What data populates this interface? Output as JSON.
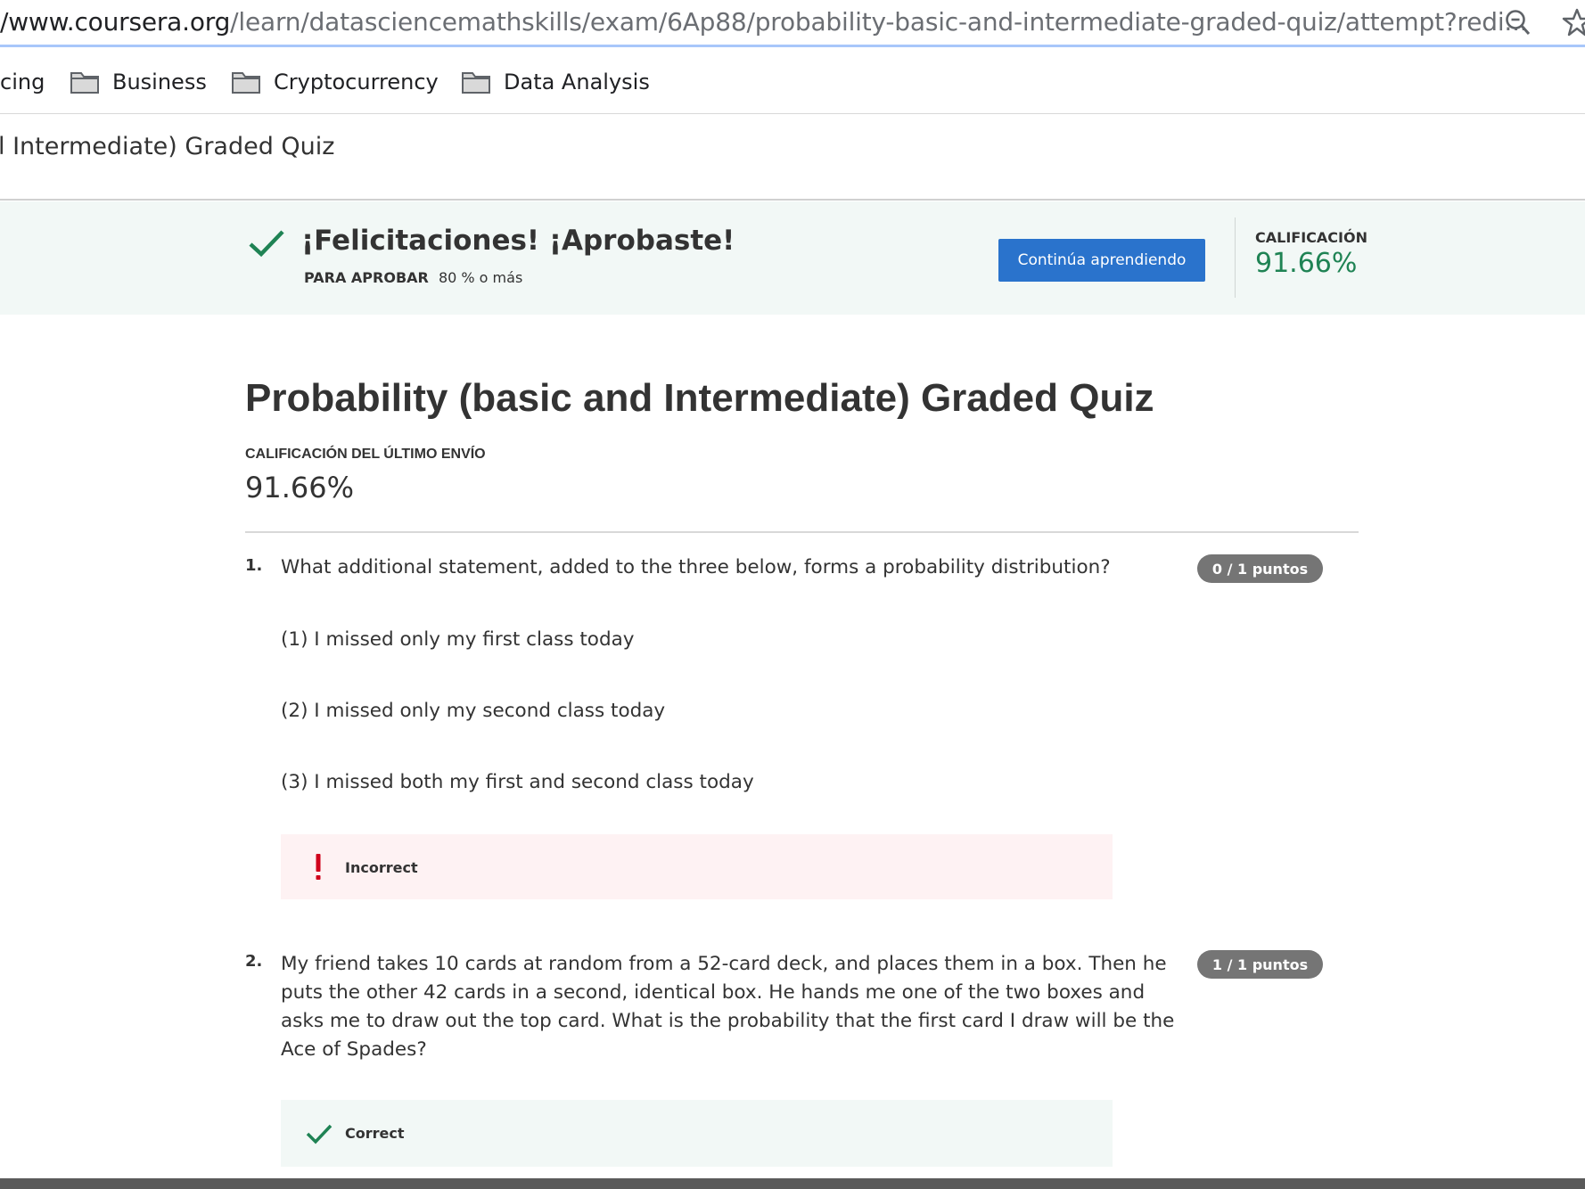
{
  "browser": {
    "url_host": "/www.coursera.org",
    "url_path": "/learn/datasciencemathskills/exam/6Ap88/probability-basic-and-intermediate-graded-quiz/attempt?redi..."
  },
  "bookmarks": [
    {
      "label": "cing"
    },
    {
      "label": "Business"
    },
    {
      "label": "Cryptocurrency"
    },
    {
      "label": "Data Analysis"
    }
  ],
  "page_header": {
    "breadcrumb_title": "l Intermediate) Graded Quiz"
  },
  "banner": {
    "message": "¡Felicitaciones! ¡Aprobaste!",
    "pass_label": "PARA APROBAR",
    "pass_value": "80 % o más",
    "continue_button": "Continúa aprendiendo",
    "grade_label": "CALIFICACIÓN",
    "grade_value": "91.66%"
  },
  "quiz": {
    "title": "Probability (basic and Intermediate) Graded Quiz",
    "last_submission_label": "CALIFICACIÓN DEL ÚLTIMO ENVÍO",
    "last_submission_value": "91.66%",
    "questions": [
      {
        "number": "1.",
        "text": "What additional statement, added to the three below, forms a probability distribution?",
        "statements": [
          "(1) I missed only my first class today",
          "(2) I missed only my second class today",
          "(3) I missed both my first and second class today"
        ],
        "points": "0 / 1 puntos",
        "feedback": "Incorrect"
      },
      {
        "number": "2.",
        "text_lines": [
          "My friend takes 10 cards at random from a 52-card deck, and places them in a box. Then he",
          "puts the other 42 cards in a second, identical box. He hands me one of the two boxes and",
          "asks me to draw out the top card. What is the probability that the first card I draw will be the",
          "Ace of Spades?"
        ],
        "points": "1 / 1 puntos",
        "feedback": "Correct"
      }
    ]
  },
  "colors": {
    "accent_button": "#2a73cc",
    "success_green": "#1f8354",
    "error_red": "#d0021b",
    "banner_bg": "#f2f8f6",
    "incorrect_bg": "#fef2f3"
  }
}
